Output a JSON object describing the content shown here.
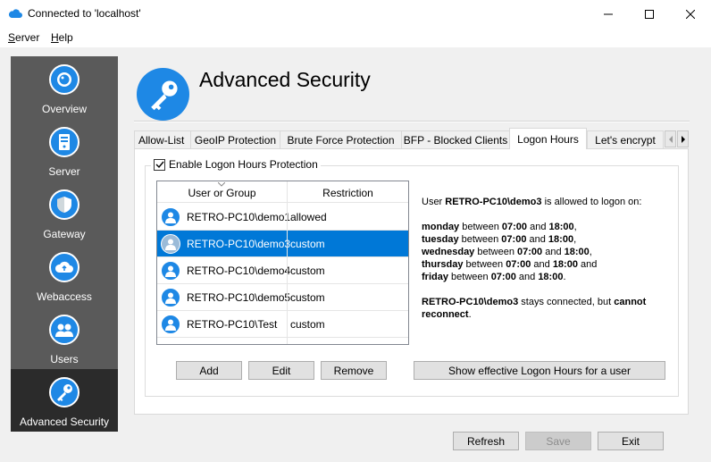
{
  "window": {
    "title": "Connected to 'localhost'"
  },
  "menu": {
    "server_label": "Server",
    "server_mnemonic": "S",
    "server_rest": "erver",
    "help_label": "Help",
    "help_mnemonic": "H",
    "help_rest": "elp"
  },
  "sidebar": {
    "items": [
      {
        "label": "Overview",
        "icon": "overview-icon"
      },
      {
        "label": "Server",
        "icon": "server-icon"
      },
      {
        "label": "Gateway",
        "icon": "shield-icon"
      },
      {
        "label": "Webaccess",
        "icon": "cloud-icon"
      },
      {
        "label": "Users",
        "icon": "users-icon"
      },
      {
        "label": "Advanced Security",
        "icon": "key-icon",
        "active": true
      }
    ]
  },
  "header": {
    "title": "Advanced Security",
    "icon": "key-icon"
  },
  "tabs": [
    {
      "label": "Allow-List"
    },
    {
      "label": "GeoIP Protection"
    },
    {
      "label": "Brute Force Protection"
    },
    {
      "label": "BFP - Blocked Clients"
    },
    {
      "label": "Logon Hours",
      "active": true
    },
    {
      "label": "Let's encrypt"
    }
  ],
  "logon_hours": {
    "enable_label": "Enable Logon Hours Protection",
    "enabled": true,
    "columns": [
      "User or Group",
      "Restriction"
    ],
    "rows": [
      {
        "user": "RETRO-PC10\\demo1",
        "restriction": "allowed",
        "selected": false
      },
      {
        "user": "RETRO-PC10\\demo3",
        "restriction": "custom",
        "selected": true
      },
      {
        "user": "RETRO-PC10\\demo4",
        "restriction": "custom",
        "selected": false
      },
      {
        "user": "RETRO-PC10\\demo5",
        "restriction": "custom",
        "selected": false
      },
      {
        "user": "RETRO-PC10\\Test",
        "restriction": "custom",
        "selected": false
      }
    ],
    "info": {
      "intro_prefix": "User",
      "intro_user": "RETRO-PC10\\demo3",
      "intro_suffix": "is allowed to logon on:",
      "between": "between",
      "and": "and",
      "schedule": [
        {
          "day": "monday",
          "from": "07:00",
          "to": "18:00",
          "end": ","
        },
        {
          "day": "tuesday",
          "from": "07:00",
          "to": "18:00",
          "end": ","
        },
        {
          "day": "wednesday",
          "from": "07:00",
          "to": "18:00",
          "end": ","
        },
        {
          "day": "thursday",
          "from": "07:00",
          "to": "18:00",
          "end": " and"
        },
        {
          "day": "friday",
          "from": "07:00",
          "to": "18:00",
          "end": "."
        }
      ],
      "note_user": "RETRO-PC10\\demo3",
      "note_mid": "stays connected, but",
      "note_strong": "cannot reconnect",
      "note_end": "."
    },
    "buttons": {
      "add": "Add",
      "edit": "Edit",
      "remove": "Remove",
      "show_effective": "Show effective Logon Hours for a user"
    }
  },
  "footer": {
    "refresh": "Refresh",
    "save": "Save",
    "exit": "Exit"
  },
  "colors": {
    "accent": "#1e88e5",
    "selection": "#0078d7",
    "sidebar_bg": "#5a5a5a",
    "sidebar_active": "#2b2b2b"
  }
}
